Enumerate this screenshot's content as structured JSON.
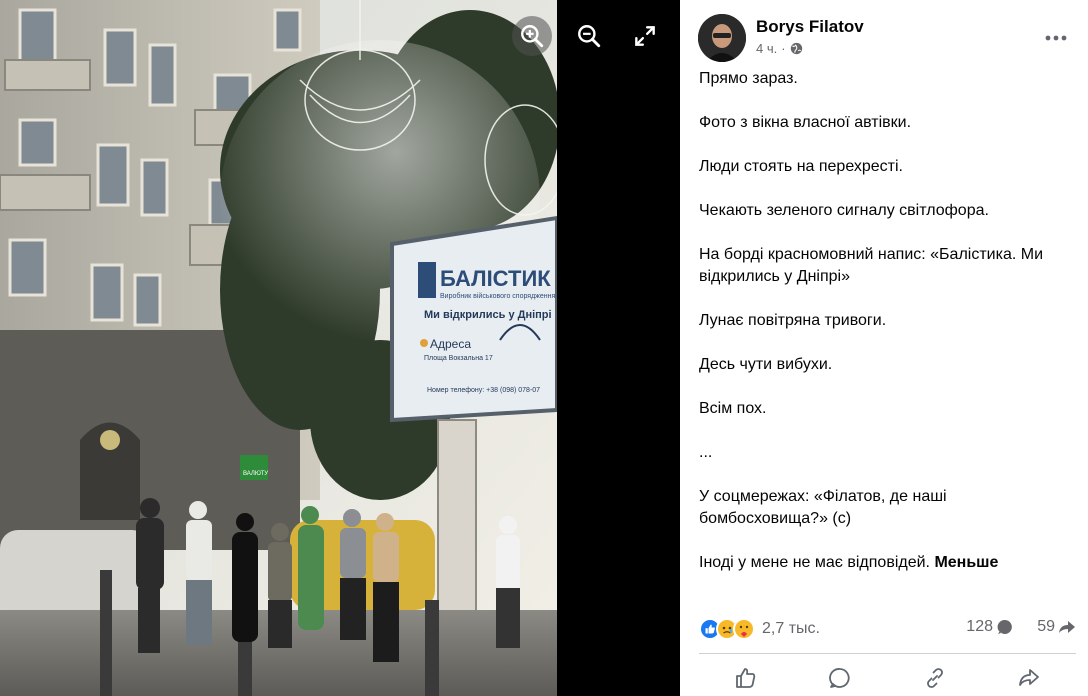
{
  "photo_viewer": {
    "controls": [
      {
        "name": "zoom-in",
        "icon": "zoom-in-icon"
      },
      {
        "name": "zoom-out",
        "icon": "zoom-out-icon"
      },
      {
        "name": "fullscreen",
        "icon": "fullscreen-icon"
      }
    ],
    "billboard": {
      "brand": "БАЛІСТИК",
      "tagline": "Виробник військового спорядження",
      "headline": "Ми відкрились у Дніпрі",
      "address_label": "Адреса",
      "address": "Площа Вокзальна 17",
      "phone": "Номер телефону: +38 (098) 078-07"
    },
    "shop_sign": "ВАЛЮТУ"
  },
  "post": {
    "author": "Borys Filatov",
    "time": "4 ч.",
    "separator": "·",
    "audience_icon": "globe-icon",
    "more_icon": "more-horizontal-icon",
    "paragraphs": [
      "Прямо зараз.",
      "Фото з вікна власної автівки.",
      "Люди стоять на перехресті.",
      "Чекають зеленого сигналу світлофора.",
      "На борді красномовний напис: «Балістика. Ми відкрились у Дніпрі»",
      "Лунає повітряна тривоги.",
      "Десь чути вибухи.",
      "Всім пох.",
      "...",
      "У соцмережах: «Філатов, де наші бомбосховища?» (с)"
    ],
    "last_paragraph": "Іноді у мене не має відповідей.",
    "see_less": "Меньше"
  },
  "stats": {
    "reactions": [
      "like",
      "sad",
      "care"
    ],
    "reaction_count": "2,7 тыс.",
    "comments": "128",
    "shares": "59"
  },
  "actions": [
    {
      "name": "like",
      "icon": "like-icon"
    },
    {
      "name": "comment",
      "icon": "comment-icon"
    },
    {
      "name": "copy-link",
      "icon": "link-icon"
    },
    {
      "name": "share",
      "icon": "share-icon"
    }
  ],
  "colors": {
    "text": "#050505",
    "secondary": "#65676b",
    "like_blue": "#1877f2",
    "divider": "#ced0d4"
  }
}
